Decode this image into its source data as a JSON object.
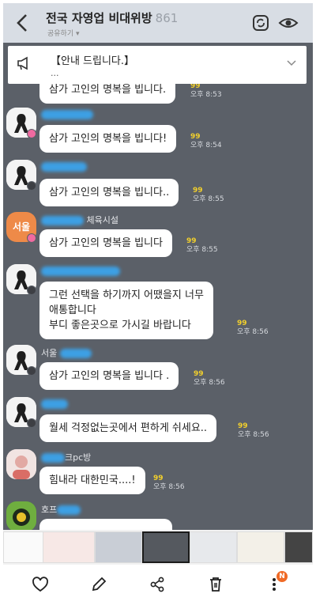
{
  "header": {
    "title": "전국 자영업 비대위방",
    "member_count": "861",
    "subtitle": "공유하기 ▾"
  },
  "notice": {
    "title": "【안내 드립니다.】",
    "preview": "..."
  },
  "messages": [
    {
      "text": "삼가 고인의 명복을 빕니다.",
      "unread": "99",
      "time": "오후 8:53"
    },
    {
      "text": "삼가 고인의 명복을 빕니다!",
      "unread": "99",
      "time": "오후 8:54"
    },
    {
      "text": "삼가 고인의 명복을 빕니다..",
      "unread": "99",
      "time": "오후 8:55"
    },
    {
      "nick_suffix": "체육시설",
      "text": "삼가 고인의 명복을 빕니다",
      "unread": "99",
      "time": "오후 8:55",
      "avatar_text": "서울"
    },
    {
      "text": "그런 선택을 하기까지 어땠을지 너무 애통합니다\n부디 좋은곳으로 가시길 바랍니다",
      "line1": "그런 선택을 하기까지 어땠을지 너무",
      "line2": "애통합니다",
      "line3": "부디 좋은곳으로 가시길 바랍니다",
      "unread": "99",
      "time": "오후 8:56"
    },
    {
      "nick_prefix": "서울",
      "text": "삼가 고인의 명복을 빕니다 .",
      "unread": "99",
      "time": "오후 8:56"
    },
    {
      "text": "월세 걱정없는곳에서 편하게 쉬세요..",
      "unread": "99",
      "time": "오후 8:56"
    },
    {
      "nick_suffix": "크pc방",
      "text": "힘내라 대한민국....!",
      "unread": "99",
      "time": "오후 8:56"
    },
    {
      "nick_prefix": "호프"
    }
  ],
  "toolbar": {
    "items": [
      "heart-icon",
      "pen-icon",
      "share-icon",
      "trash-icon",
      "more-icon"
    ],
    "notification_badge": "N"
  },
  "colors": {
    "chat_bg": "#5b6068",
    "header_bg": "#d8dde4",
    "unread": "#f2d02c",
    "blur_nick": "#3aa7f2"
  }
}
